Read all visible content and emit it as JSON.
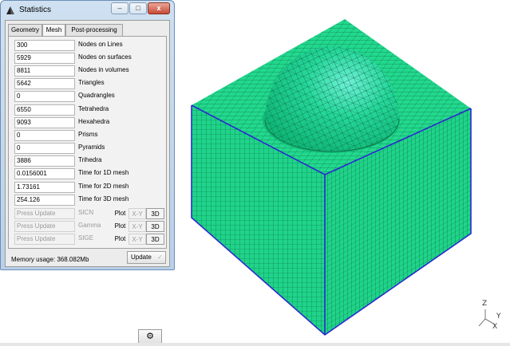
{
  "window": {
    "title": "Statistics",
    "close_label": "x",
    "min_label": "–",
    "max_label": "□"
  },
  "tabs": [
    {
      "label": "Geometry"
    },
    {
      "label": "Mesh"
    },
    {
      "label": "Post-processing"
    }
  ],
  "mesh_stats": [
    {
      "value": "300",
      "label": "Nodes on Lines"
    },
    {
      "value": "5929",
      "label": "Nodes on surfaces"
    },
    {
      "value": "8811",
      "label": "Nodes in volumes"
    },
    {
      "value": "5642",
      "label": "Triangles"
    },
    {
      "value": "0",
      "label": "Quadrangles"
    },
    {
      "value": "6550",
      "label": "Tetrahedra"
    },
    {
      "value": "9093",
      "label": "Hexahedra"
    },
    {
      "value": "0",
      "label": "Prisms"
    },
    {
      "value": "0",
      "label": "Pyramids"
    },
    {
      "value": "3886",
      "label": "Trihedra"
    },
    {
      "value": "0.0156001",
      "label": "Time for 1D mesh"
    },
    {
      "value": "1.73161",
      "label": "Time for 2D mesh"
    },
    {
      "value": "254.126",
      "label": "Time for 3D mesh"
    }
  ],
  "quality_rows": [
    {
      "value": "Press Update",
      "name": "SICN",
      "plot": "Plot",
      "xy": "X-Y",
      "d3": "3D"
    },
    {
      "value": "Press Update",
      "name": "Gamma",
      "plot": "Plot",
      "xy": "X-Y",
      "d3": "3D"
    },
    {
      "value": "Press Update",
      "name": "SIGE",
      "plot": "Plot",
      "xy": "X-Y",
      "d3": "3D"
    }
  ],
  "memory": "Memory usage: 368.082Mb",
  "update_label": "Update",
  "update_icon": "checkmark-icon",
  "gear_icon": "gear-icon",
  "axes": {
    "z": "Z",
    "y": "Y",
    "x": "X"
  },
  "colors": {
    "mesh_face": "#1fd48a",
    "mesh_line": "#0a5a3a",
    "edge": "#2020c0"
  }
}
